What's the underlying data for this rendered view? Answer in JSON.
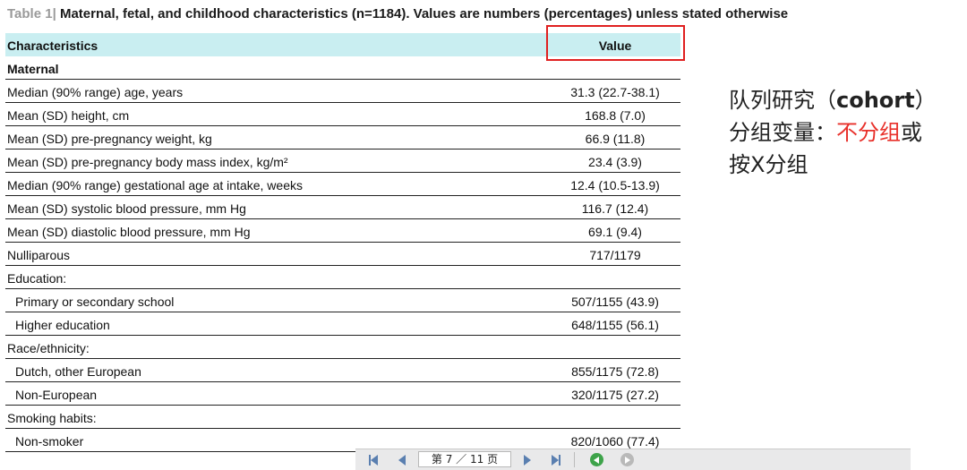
{
  "title": {
    "label": "Table 1|",
    "text": "Maternal, fetal, and childhood characteristics (n=1184). Values are numbers (percentages) unless stated otherwise"
  },
  "table": {
    "headers": [
      "Characteristics",
      "Value"
    ],
    "rows": [
      {
        "label": "Maternal",
        "value": "",
        "style": "section"
      },
      {
        "label": "Median (90% range) age, years",
        "value": "31.3 (22.7-38.1)",
        "style": "normal"
      },
      {
        "label": "Mean (SD) height, cm",
        "value": "168.8 (7.0)",
        "style": "normal"
      },
      {
        "label": "Mean (SD) pre-pregnancy weight, kg",
        "value": "66.9 (11.8)",
        "style": "normal"
      },
      {
        "label": "Mean (SD) pre-pregnancy body mass index, kg/m²",
        "value": "23.4 (3.9)",
        "style": "normal"
      },
      {
        "label": "Median (90% range) gestational age at intake, weeks",
        "value": "12.4 (10.5-13.9)",
        "style": "normal"
      },
      {
        "label": "Mean (SD) systolic blood pressure, mm Hg",
        "value": "116.7 (12.4)",
        "style": "normal"
      },
      {
        "label": "Mean (SD) diastolic blood pressure, mm Hg",
        "value": "69.1 (9.4)",
        "style": "normal"
      },
      {
        "label": "Nulliparous",
        "value": "717/1179",
        "style": "normal"
      },
      {
        "label": "Education:",
        "value": "",
        "style": "normal"
      },
      {
        "label": "Primary or secondary school",
        "value": "507/1155 (43.9)",
        "style": "indent"
      },
      {
        "label": "Higher education",
        "value": "648/1155 (56.1)",
        "style": "indent"
      },
      {
        "label": "Race/ethnicity:",
        "value": "",
        "style": "normal"
      },
      {
        "label": "Dutch, other European",
        "value": "855/1175 (72.8)",
        "style": "indent"
      },
      {
        "label": "Non-European",
        "value": "320/1175 (27.2)",
        "style": "indent"
      },
      {
        "label": "Smoking habits:",
        "value": "",
        "style": "normal"
      },
      {
        "label": "Non-smoker",
        "value": "820/1060 (77.4)",
        "style": "indent"
      }
    ]
  },
  "note": {
    "line1_a": "队列研究（",
    "line1_b": "cohort",
    "line1_c": "）",
    "line2_a": "分组变量：",
    "line2_b": "不分组",
    "line2_c": "或",
    "line3": "按X分组"
  },
  "pager": {
    "page_text": "第 7 ／ 11 页"
  },
  "colors": {
    "header_bg": "#c9eef1",
    "highlight_box": "#e02020",
    "note_red": "#e8302a"
  }
}
